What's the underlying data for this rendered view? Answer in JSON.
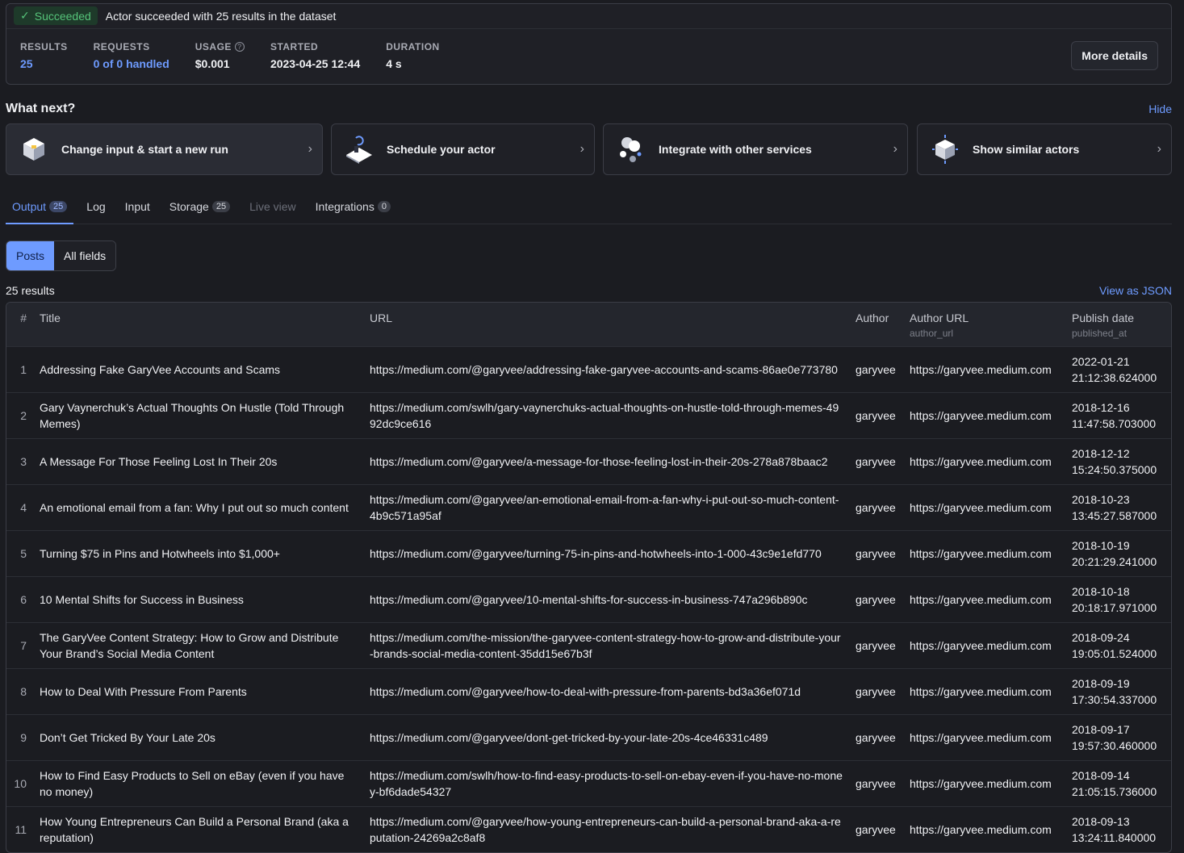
{
  "run": {
    "status": "Succeeded",
    "message": "Actor succeeded with 25 results in the dataset",
    "stats": [
      {
        "label": "RESULTS",
        "value": "25",
        "link": true
      },
      {
        "label": "REQUESTS",
        "value": "0 of 0 handled",
        "link": true
      },
      {
        "label": "USAGE",
        "value": "$0.001",
        "link": false,
        "help": true
      },
      {
        "label": "STARTED",
        "value": "2023-04-25 12:44",
        "link": false
      },
      {
        "label": "DURATION",
        "value": "4 s",
        "link": false
      }
    ],
    "more_details": "More details"
  },
  "whatnext": {
    "title": "What next?",
    "hide": "Hide",
    "cards": [
      {
        "label": "Change input & start a new run",
        "icon": "box-icon"
      },
      {
        "label": "Schedule your actor",
        "icon": "schedule-icon"
      },
      {
        "label": "Integrate with other services",
        "icon": "integrations-icon"
      },
      {
        "label": "Show similar actors",
        "icon": "similar-actors-icon"
      }
    ]
  },
  "tabs": [
    {
      "label": "Output",
      "count": "25",
      "active": true
    },
    {
      "label": "Log"
    },
    {
      "label": "Input"
    },
    {
      "label": "Storage",
      "count": "25"
    },
    {
      "label": "Live view",
      "disabled": true
    },
    {
      "label": "Integrations",
      "count": "0"
    }
  ],
  "view_toggle": {
    "posts": "Posts",
    "all_fields": "All fields"
  },
  "results_count": "25 results",
  "view_json": "View as JSON",
  "table": {
    "headers": {
      "num": "#",
      "title": "Title",
      "url": "URL",
      "author": "Author",
      "author_url": "Author URL",
      "author_url_sub": "author_url",
      "publish": "Publish date",
      "publish_sub": "published_at"
    },
    "rows": [
      {
        "n": "1",
        "title": "Addressing Fake GaryVee Accounts and Scams",
        "url": "https://medium.com/@garyvee/addressing-fake-garyvee-accounts-and-scams-86ae0e773780",
        "author": "garyvee",
        "author_url": "https://garyvee.medium.com",
        "date": "2022-01-21",
        "time": "21:12:38.624000"
      },
      {
        "n": "2",
        "title": "Gary Vaynerchuk’s Actual Thoughts On Hustle (Told Through Memes)",
        "url": "https://medium.com/swlh/gary-vaynerchuks-actual-thoughts-on-hustle-told-through-memes-4992dc9ce616",
        "author": "garyvee",
        "author_url": "https://garyvee.medium.com",
        "date": "2018-12-16",
        "time": "11:47:58.703000"
      },
      {
        "n": "3",
        "title": "A Message For Those Feeling Lost In Their 20s",
        "url": "https://medium.com/@garyvee/a-message-for-those-feeling-lost-in-their-20s-278a878baac2",
        "author": "garyvee",
        "author_url": "https://garyvee.medium.com",
        "date": "2018-12-12",
        "time": "15:24:50.375000"
      },
      {
        "n": "4",
        "title": "An emotional email from a fan: Why I put out so much content",
        "url": "https://medium.com/@garyvee/an-emotional-email-from-a-fan-why-i-put-out-so-much-content-4b9c571a95af",
        "author": "garyvee",
        "author_url": "https://garyvee.medium.com",
        "date": "2018-10-23",
        "time": "13:45:27.587000"
      },
      {
        "n": "5",
        "title": "Turning $75 in Pins and Hotwheels into $1,000+",
        "url": "https://medium.com/@garyvee/turning-75-in-pins-and-hotwheels-into-1-000-43c9e1efd770",
        "author": "garyvee",
        "author_url": "https://garyvee.medium.com",
        "date": "2018-10-19",
        "time": "20:21:29.241000"
      },
      {
        "n": "6",
        "title": "10 Mental Shifts for Success in Business",
        "url": "https://medium.com/@garyvee/10-mental-shifts-for-success-in-business-747a296b890c",
        "author": "garyvee",
        "author_url": "https://garyvee.medium.com",
        "date": "2018-10-18",
        "time": "20:18:17.971000"
      },
      {
        "n": "7",
        "title": "The GaryVee Content Strategy: How to Grow and Distribute Your Brand’s Social Media Content",
        "url": "https://medium.com/the-mission/the-garyvee-content-strategy-how-to-grow-and-distribute-your-brands-social-media-content-35dd15e67b3f",
        "author": "garyvee",
        "author_url": "https://garyvee.medium.com",
        "date": "2018-09-24",
        "time": "19:05:01.524000"
      },
      {
        "n": "8",
        "title": "How to Deal With Pressure From Parents",
        "url": "https://medium.com/@garyvee/how-to-deal-with-pressure-from-parents-bd3a36ef071d",
        "author": "garyvee",
        "author_url": "https://garyvee.medium.com",
        "date": "2018-09-19",
        "time": "17:30:54.337000"
      },
      {
        "n": "9",
        "title": "Don’t Get Tricked By Your Late 20s",
        "url": "https://medium.com/@garyvee/dont-get-tricked-by-your-late-20s-4ce46331c489",
        "author": "garyvee",
        "author_url": "https://garyvee.medium.com",
        "date": "2018-09-17",
        "time": "19:57:30.460000"
      },
      {
        "n": "10",
        "title": "How to Find Easy Products to Sell on eBay (even if you have no money)",
        "url": "https://medium.com/swlh/how-to-find-easy-products-to-sell-on-ebay-even-if-you-have-no-money-bf6dade54327",
        "author": "garyvee",
        "author_url": "https://garyvee.medium.com",
        "date": "2018-09-14",
        "time": "21:05:15.736000"
      },
      {
        "n": "11",
        "title": "How Young Entrepreneurs Can Build a Personal Brand (aka a reputation)",
        "url": "https://medium.com/@garyvee/how-young-entrepreneurs-can-build-a-personal-brand-aka-a-reputation-24269a2c8af8",
        "author": "garyvee",
        "author_url": "https://garyvee.medium.com",
        "date": "2018-09-13",
        "time": "13:24:11.840000"
      }
    ]
  },
  "colors": {
    "accent": "#6e9bff",
    "success": "#56c47a",
    "background": "#1b1c21"
  }
}
